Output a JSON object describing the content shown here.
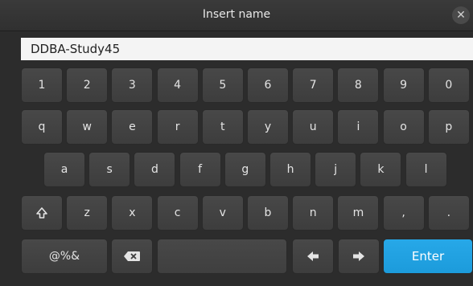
{
  "dialog": {
    "title": "Insert name",
    "close_icon": "close-icon"
  },
  "input": {
    "value": "DDBA-Study45"
  },
  "keyboard": {
    "row_numbers": [
      "1",
      "2",
      "3",
      "4",
      "5",
      "6",
      "7",
      "8",
      "9",
      "0"
    ],
    "row_top": [
      "q",
      "w",
      "e",
      "r",
      "t",
      "y",
      "u",
      "i",
      "o",
      "p"
    ],
    "row_middle": [
      "a",
      "s",
      "d",
      "f",
      "g",
      "h",
      "j",
      "k",
      "l"
    ],
    "row_bottom": {
      "shift_icon": "shift-icon",
      "keys": [
        "z",
        "x",
        "c",
        "v",
        "b",
        "n",
        "m",
        ",",
        "."
      ]
    },
    "row_actions": {
      "symbols_label": "@%&",
      "backspace_icon": "backspace-icon",
      "space_label": "",
      "left_arrow_icon": "arrow-left-icon",
      "right_arrow_icon": "arrow-right-icon",
      "enter_label": "Enter"
    }
  },
  "colors": {
    "enter_key": "#1c9bdb",
    "background": "#2c2c2c",
    "key": "#444444"
  }
}
